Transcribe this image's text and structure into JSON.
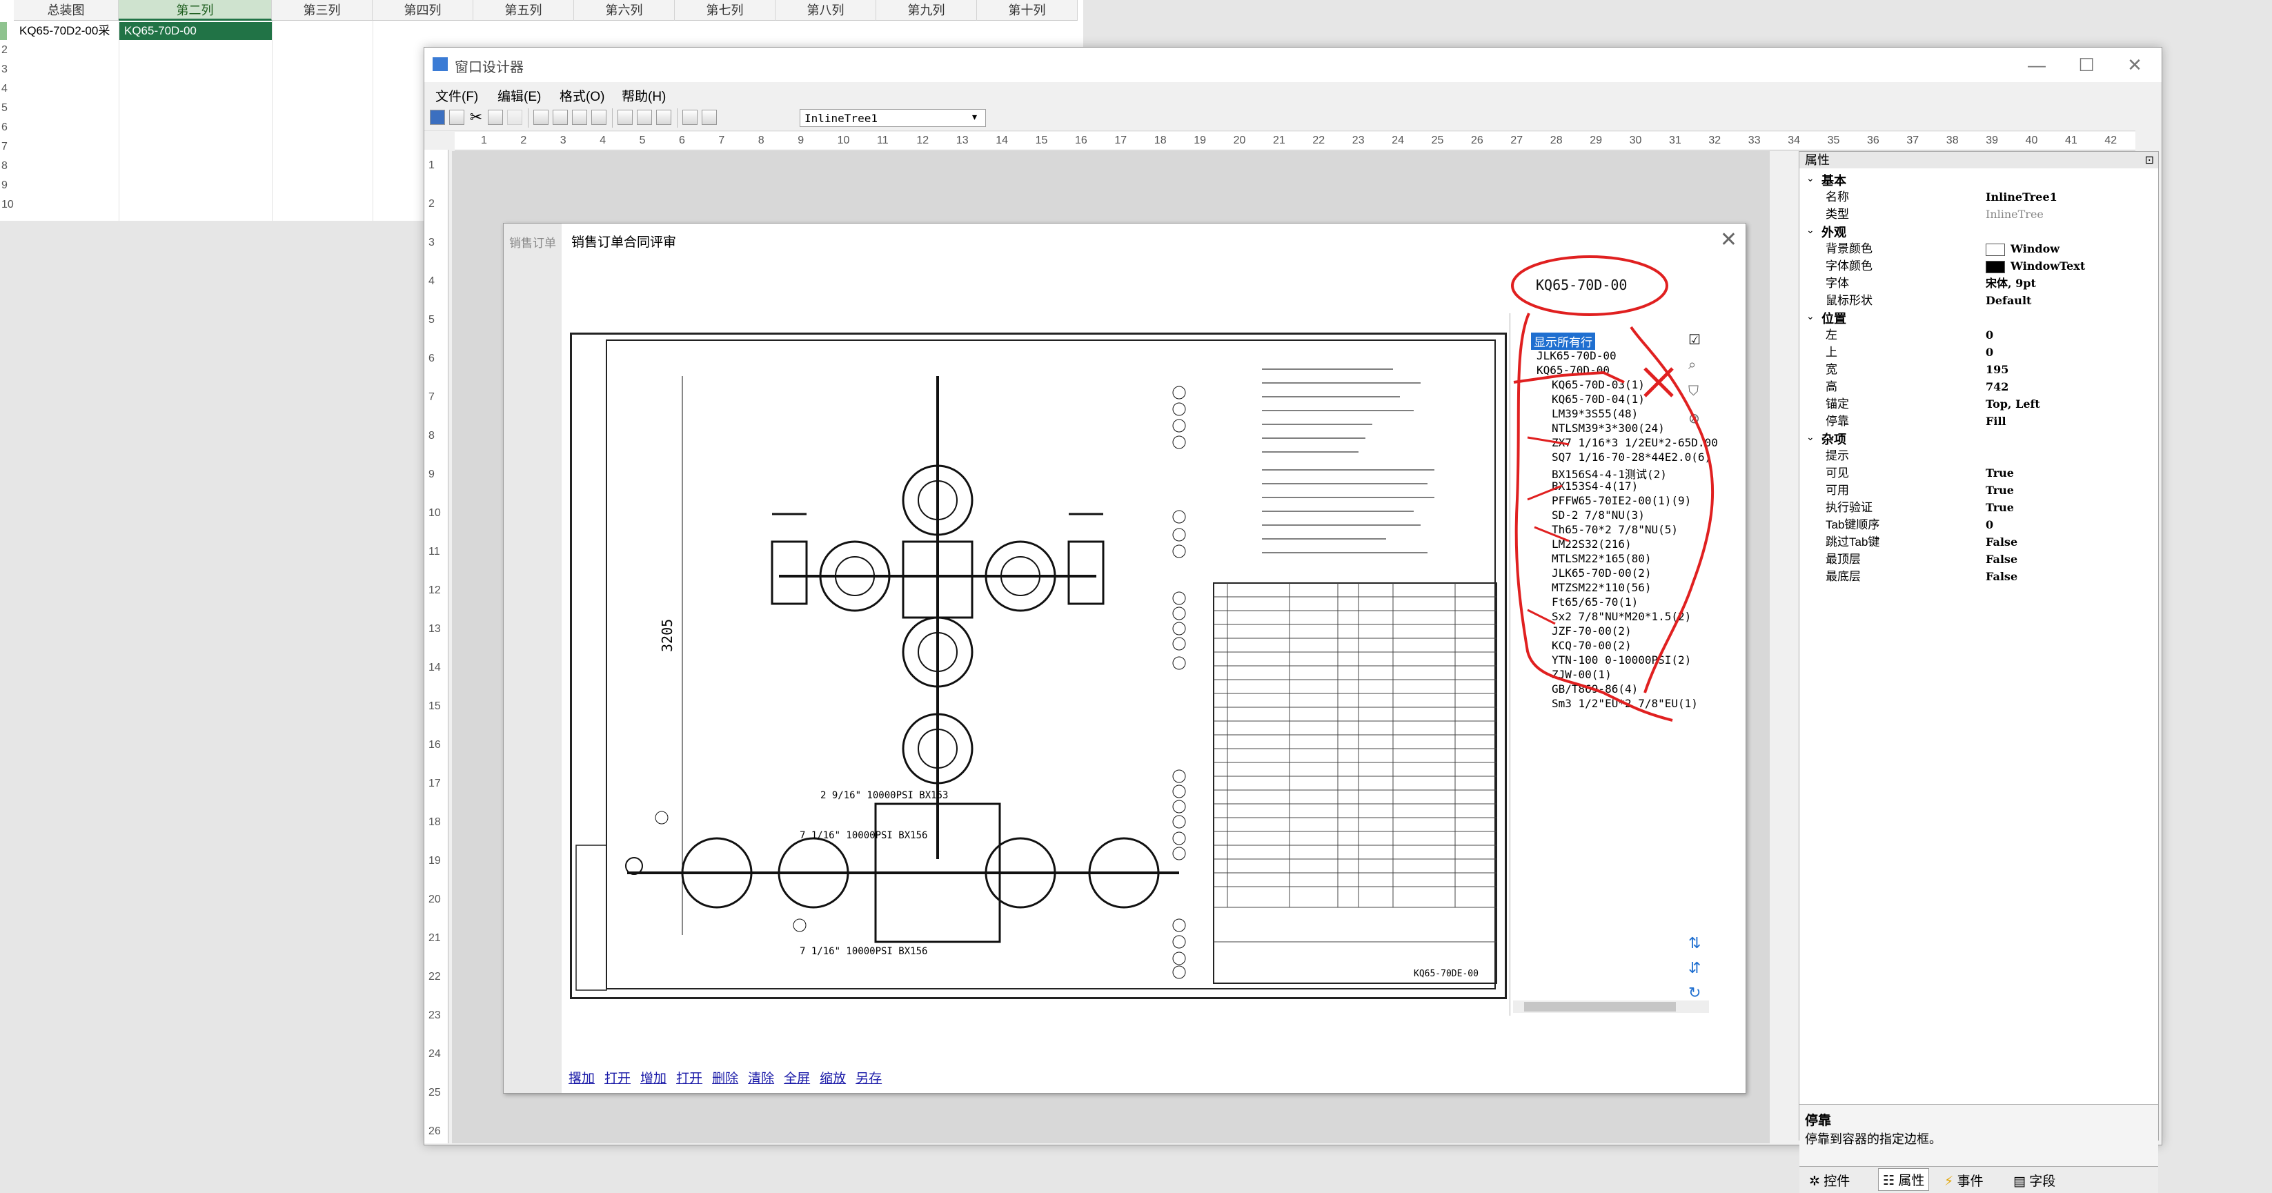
{
  "sheet": {
    "columns": [
      "总装图",
      "第二列",
      "第三列",
      "第四列",
      "第五列",
      "第六列",
      "第七列",
      "第八列",
      "第九列",
      "第十列"
    ],
    "rows": [
      "2",
      "3",
      "4",
      "5",
      "6",
      "7",
      "8",
      "9",
      "10"
    ],
    "row1": {
      "col1": "KQ65-70D2-00采",
      "col2": "KQ65-70D-00"
    }
  },
  "window": {
    "title": "窗口设计器",
    "controls": {
      "min": "—",
      "max": "☐",
      "close": "✕"
    }
  },
  "menu": [
    "文件(F)",
    "编辑(E)",
    "格式(O)",
    "帮助(H)"
  ],
  "toolbar": {
    "combo_value": "InlineTree1"
  },
  "ruler": {
    "top": [
      "1",
      "2",
      "3",
      "4",
      "5",
      "6",
      "7",
      "8",
      "9",
      "10",
      "11",
      "12",
      "13",
      "14",
      "15",
      "16",
      "17",
      "18",
      "19",
      "20",
      "21",
      "22",
      "23",
      "24",
      "25",
      "26",
      "27",
      "28",
      "29",
      "30",
      "31",
      "32",
      "33",
      "34",
      "35",
      "36",
      "37",
      "38",
      "39",
      "40",
      "41",
      "42"
    ],
    "left": [
      "1",
      "2",
      "3",
      "4",
      "5",
      "6",
      "7",
      "8",
      "9",
      "10",
      "11",
      "12",
      "13",
      "14",
      "15",
      "16",
      "17",
      "18",
      "19",
      "20",
      "21",
      "22",
      "23",
      "24",
      "25",
      "26"
    ]
  },
  "form": {
    "ghost_title": "销售订单",
    "dialog_title": "销售订单合同评审",
    "dialog_close": "✕",
    "annotation": "KQ65-70D-00",
    "drawing_label": "3205",
    "drawing_notes": [
      "2 9/16\" 10000PSI BX153",
      "7 1/16\" 10000PSI BX156",
      "7 1/16\" 10000PSI BX156"
    ],
    "drawing_number": "KQ65-70DE-00"
  },
  "tree": {
    "header": "显示所有行",
    "root": "JLK65-70D-00",
    "sub": "KQ65-70D-00",
    "items": [
      "KQ65-70D-03(1)",
      "KQ65-70D-04(1)",
      "LM39*3S55(48)",
      "NTLSM39*3*300(24)",
      "ZX7 1/16*3 1/2EU*2-65D.00",
      "SQ7 1/16-70-28*44E2.0(6)",
      "BX156S4-4-1测试(2)",
      "BX153S4-4(17)",
      "PFFW65-70IE2-00(1)(9)",
      "SD-2 7/8\"NU(3)",
      "Th65-70*2 7/8\"NU(5)",
      "LM22S32(216)",
      "MTLSM22*165(80)",
      "JLK65-70D-00(2)",
      "MTZSM22*110(56)",
      "Ft65/65-70(1)",
      "Sx2 7/8\"NU*M20*1.5(2)",
      "JZF-70-00(2)",
      "KCQ-70-00(2)",
      "YTN-100 0-10000PSI(2)",
      "ZJW-00(1)",
      "GB/T869-86(4)",
      "Sm3 1/2\"EU*2 7/8\"EU(1)"
    ]
  },
  "links": [
    "撂加",
    "打开",
    "增加",
    "打开",
    "删除",
    "清除",
    "全屏",
    "缩放",
    "另存"
  ],
  "props": {
    "header": "属性",
    "categories": {
      "basic": "基本",
      "appearance": "外观",
      "position": "位置",
      "misc": "杂项"
    },
    "basic": [
      {
        "name": "名称",
        "value": "InlineTree1"
      },
      {
        "name": "类型",
        "value": "InlineTree"
      }
    ],
    "appearance": [
      {
        "name": "背景颜色",
        "value": "Window"
      },
      {
        "name": "字体颜色",
        "value": "WindowText"
      },
      {
        "name": "字体",
        "value": "宋体, 9pt"
      },
      {
        "name": "鼠标形状",
        "value": "Default"
      }
    ],
    "position": [
      {
        "name": "左",
        "value": "0"
      },
      {
        "name": "上",
        "value": "0"
      },
      {
        "name": "宽",
        "value": "195"
      },
      {
        "name": "高",
        "value": "742"
      },
      {
        "name": "锚定",
        "value": "Top, Left"
      },
      {
        "name": "停靠",
        "value": "Fill"
      }
    ],
    "misc": [
      {
        "name": "提示",
        "value": ""
      },
      {
        "name": "可见",
        "value": "True"
      },
      {
        "name": "可用",
        "value": "True"
      },
      {
        "name": "执行验证",
        "value": "True"
      },
      {
        "name": "Tab键顺序",
        "value": "0"
      },
      {
        "name": "跳过Tab键",
        "value": "False"
      },
      {
        "name": "最顶层",
        "value": "False"
      },
      {
        "name": "最底层",
        "value": "False"
      }
    ],
    "desc_title": "停靠",
    "desc_text": "停靠到容器的指定边框。",
    "tabs": [
      "控件",
      "属性",
      "事件",
      "字段"
    ]
  },
  "colors": {
    "annotation": "#e02020",
    "accent": "#217346",
    "tree_header_bg": "#1f6fd0"
  }
}
